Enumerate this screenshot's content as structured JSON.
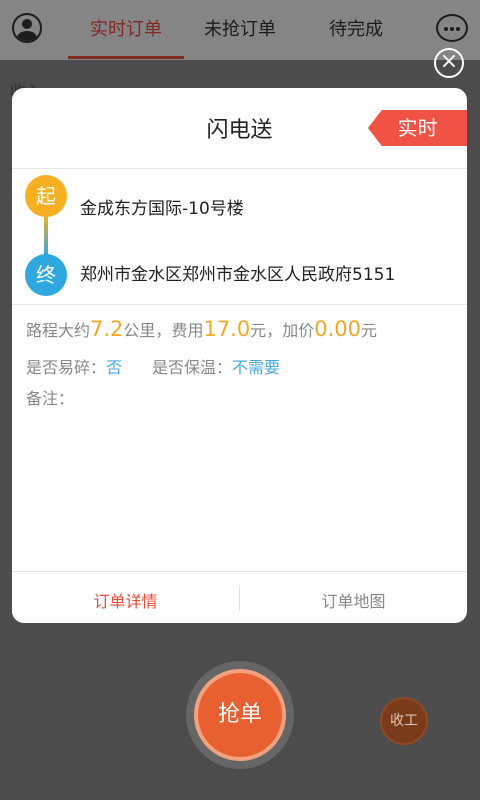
{
  "header": {
    "tabs": [
      {
        "label": "实时订单",
        "active": true
      },
      {
        "label": "未抢订单",
        "active": false
      },
      {
        "label": "待完成",
        "active": false
      }
    ]
  },
  "background_peek": {
    "date_text": "收入"
  },
  "modal": {
    "title": "闪电送",
    "badge": "实时",
    "start": {
      "icon_label": "起",
      "address": "金成东方国际-10号楼"
    },
    "end": {
      "icon_label": "终",
      "address": "郑州市金水区郑州市金水区人民政府5151"
    },
    "distance": {
      "prefix": "路程大约",
      "value": "7.2",
      "unit": "公里，"
    },
    "fee": {
      "prefix": "费用",
      "value": "17.0",
      "unit": "元，"
    },
    "extra": {
      "prefix": "加价",
      "value": "0.00",
      "unit": "元"
    },
    "fragile": {
      "label": "是否易碎：",
      "value": "否"
    },
    "keep_warm": {
      "label": "是否保温：",
      "value": "不需要"
    },
    "notes_label": "备注：",
    "footer": {
      "details": "订单详情",
      "map": "订单地图"
    }
  },
  "actions": {
    "grab": "抢单",
    "stop": "收工"
  },
  "colors": {
    "accent": "#e84c3d",
    "orange": "#f5a623",
    "blue": "#4aa8e0",
    "start": "#f7b021",
    "end": "#2fa8e0"
  }
}
